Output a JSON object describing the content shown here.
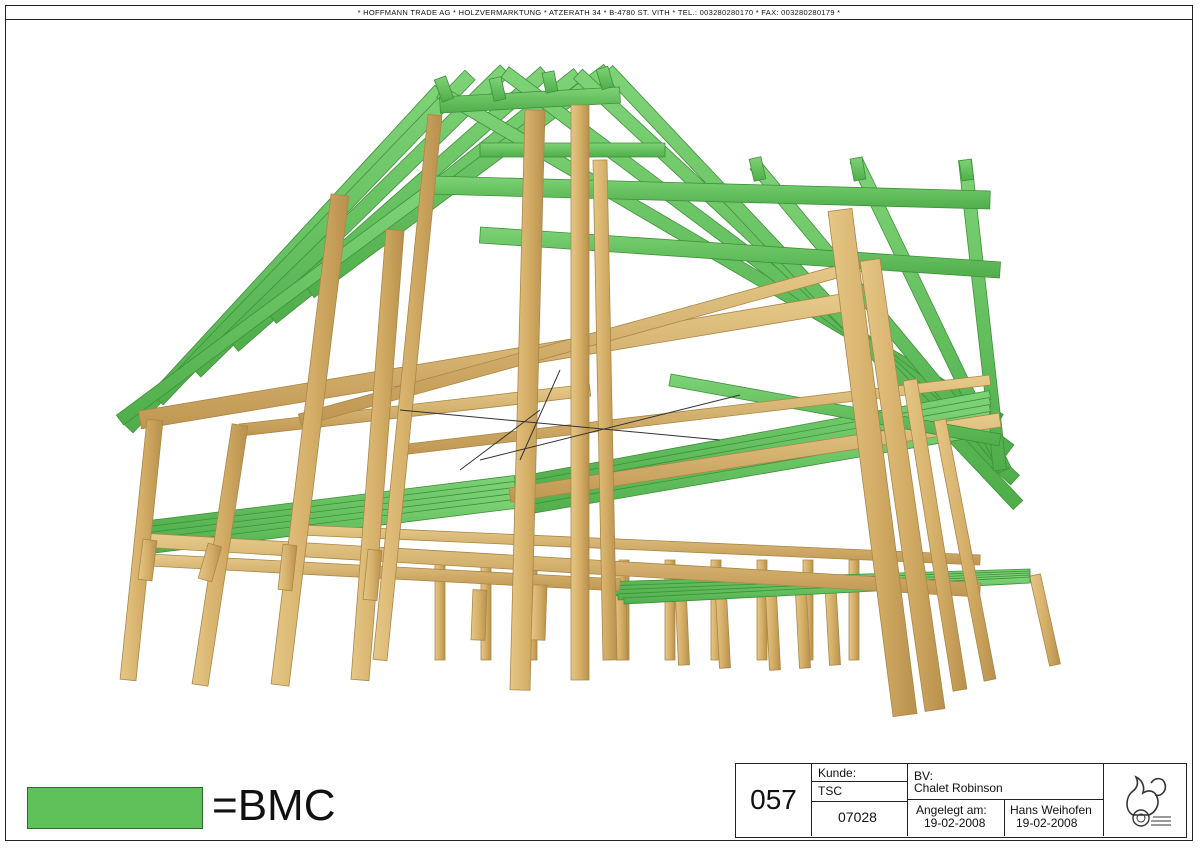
{
  "header": {
    "company_line": "*   HOFFMANN TRADE AG  *  HOLZVERMARKTUNG   *  ATZERATH 34  *  B-4780 ST. VITH   *  TEL.: 003280280170  *  FAX: 003280280179   *"
  },
  "legend": {
    "label": "=BMC",
    "color": "#5fc15a"
  },
  "title_block": {
    "number": "057",
    "kunde_label": "Kunde:",
    "kunde_value": "TSC",
    "order_number": "07028",
    "bv_label": "BV:",
    "bv_value": "Chalet Robinson",
    "angelegt_label": "Angelegt am:",
    "angelegt_date": "19-02-2008",
    "author": "Hans Weihofen",
    "author_date": "19-02-2008",
    "logo_icon": "squirrel-saw-logo-icon"
  },
  "colors": {
    "timber": "#d7b36d",
    "timber_dark": "#a98749",
    "bmc_green": "#5fc15a",
    "bmc_green_dark": "#3f8f3b"
  }
}
